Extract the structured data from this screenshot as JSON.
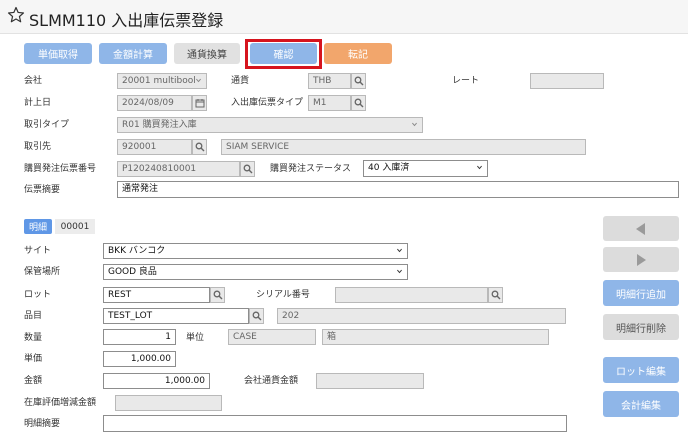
{
  "header": {
    "title": "SLMM110 入出庫伝票登録"
  },
  "toolbar": {
    "unit_price_label": "単価取得",
    "amount_calc_label": "金額計算",
    "currency_conv_label": "通貨換算",
    "confirm_label": "確認",
    "post_label": "転記"
  },
  "form": {
    "company_label": "会社",
    "company_value": "20001 multibool",
    "currency_label": "通貨",
    "currency_value": "THB",
    "rate_label": "レート",
    "rate_value": "",
    "posting_date_label": "計上日",
    "posting_date_value": "2024/08/09",
    "slip_type_label": "入出庫伝票タイプ",
    "slip_type_value": "M1",
    "txn_type_label": "取引タイプ",
    "txn_type_value": "R01 購買発注入庫",
    "partner_label": "取引先",
    "partner_code": "920001",
    "partner_name": "SIAM SERVICE",
    "po_no_label": "購買発注伝票番号",
    "po_no_value": "P120240810001",
    "po_status_label": "購買発注ステータス",
    "po_status_value": "40 入庫済",
    "memo_label": "伝票摘要",
    "memo_value": "通常発注"
  },
  "detail": {
    "tab_label": "明細",
    "line_no": "00001",
    "site_label": "サイト",
    "site_value": "BKK バンコク",
    "location_label": "保管場所",
    "location_value": "GOOD 良品",
    "lot_label": "ロット",
    "lot_value": "REST",
    "serial_label": "シリアル番号",
    "serial_value": "",
    "item_label": "品目",
    "item_value": "TEST_LOT",
    "item_extra": "202",
    "qty_label": "数量",
    "qty_value": "1",
    "unit_label": "単位",
    "unit_value": "CASE",
    "unit_name": "箱",
    "price_label": "単価",
    "price_value": "1,000.00",
    "amount_label": "金額",
    "amount_value": "1,000.00",
    "company_amount_label": "会社通貨金額",
    "company_amount_value": "",
    "valuation_label": "在庫評価増減金額",
    "valuation_value": "",
    "line_memo_label": "明細摘要",
    "line_memo_value": ""
  },
  "side": {
    "add_line_label": "明細行追加",
    "delete_line_label": "明細行削除",
    "lot_edit_label": "ロット編集",
    "accounting_edit_label": "会計編集"
  },
  "colors": {
    "accent": "#8fb6e8",
    "post": "#f2a66c",
    "highlight": "#d6141e"
  }
}
